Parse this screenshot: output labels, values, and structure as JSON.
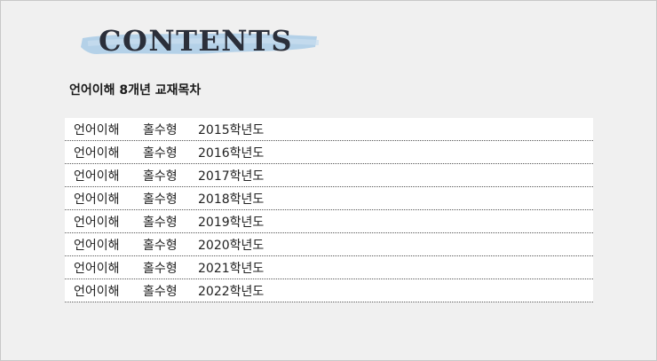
{
  "header": {
    "banner_title": "CONTENTS",
    "subtitle": "언어이해 8개년 교재목차"
  },
  "toc": {
    "rows": [
      {
        "subject": "언어이해",
        "type": "홀수형",
        "year": "2015학년도"
      },
      {
        "subject": "언어이해",
        "type": "홀수형",
        "year": "2016학년도"
      },
      {
        "subject": "언어이해",
        "type": "홀수형",
        "year": "2017학년도"
      },
      {
        "subject": "언어이해",
        "type": "홀수형",
        "year": "2018학년도"
      },
      {
        "subject": "언어이해",
        "type": "홀수형",
        "year": "2019학년도"
      },
      {
        "subject": "언어이해",
        "type": "홀수형",
        "year": "2020학년도"
      },
      {
        "subject": "언어이해",
        "type": "홀수형",
        "year": "2021학년도"
      },
      {
        "subject": "언어이해",
        "type": "홀수형",
        "year": "2022학년도"
      }
    ]
  },
  "colors": {
    "brush": "#a9cbe6",
    "title": "#2b2f3a"
  }
}
